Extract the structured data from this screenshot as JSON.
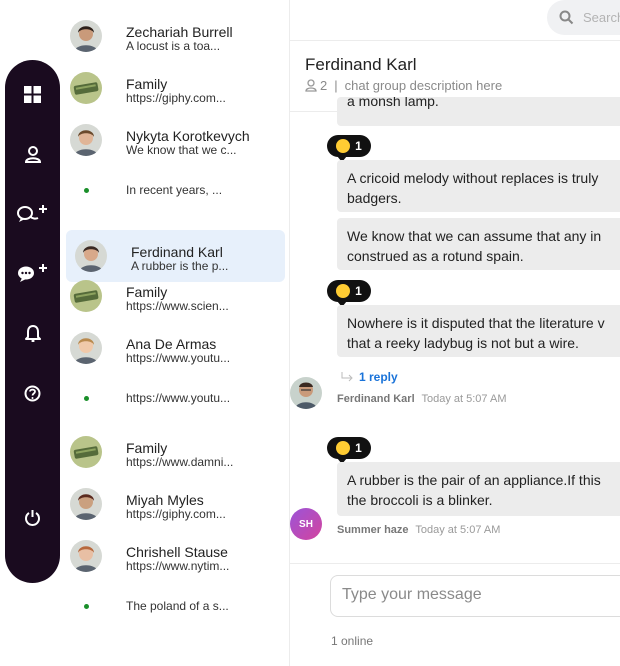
{
  "sidebar_nav": {
    "icons": [
      "grid-icon",
      "user-icon",
      "new-chat-icon",
      "new-group-icon",
      "bell-icon",
      "help-icon",
      "power-icon"
    ]
  },
  "chat_list": [
    {
      "name": "Zechariah Burrell",
      "preview": "A locust is a toa...",
      "avatar": "person"
    },
    {
      "name": "Family",
      "preview": "https://giphy.com...",
      "avatar": "group"
    },
    {
      "name": "Nykyta Korotkevych",
      "preview": "We know that we c...",
      "avatar": "person"
    },
    {
      "name": "",
      "preview": "In recent years, ...",
      "avatar": "none"
    },
    {
      "name": "Ferdinand Karl",
      "preview": "A rubber is the p...",
      "avatar": "person",
      "active": true
    },
    {
      "name": "Family",
      "preview": "https://www.scien...",
      "avatar": "group"
    },
    {
      "name": "Ana De Armas",
      "preview": "https://www.youtu...",
      "avatar": "person"
    },
    {
      "name": "",
      "preview": "https://www.youtu...",
      "avatar": "none"
    },
    {
      "name": "Family",
      "preview": "https://www.damni...",
      "avatar": "group"
    },
    {
      "name": "Miyah Myles",
      "preview": "https://giphy.com...",
      "avatar": "person"
    },
    {
      "name": "Chrishell Stause",
      "preview": "https://www.nytim...",
      "avatar": "person"
    },
    {
      "name": "",
      "preview": "The poland of a s...",
      "avatar": "none"
    }
  ],
  "search": {
    "placeholder": "Search"
  },
  "chat_header": {
    "title": "Ferdinand Karl",
    "member_count": "2",
    "separator": "|",
    "description": "chat group description here"
  },
  "messages": {
    "top_fragment": "a monsh lamp.",
    "group1": {
      "reaction_count": "1",
      "bubble1": [
        "A cricoid melody without replaces is truly",
        "badgers."
      ],
      "bubble2": [
        "We know that we can assume that any in",
        "construed as a rotund spain."
      ]
    },
    "group2": {
      "reaction_count": "1",
      "bubble": [
        "Nowhere is it disputed that the literature v",
        "that a reeky ladybug is not but a wire."
      ],
      "reply_label": "1 reply",
      "sender": "Ferdinand Karl",
      "time": "Today at 5:07 AM"
    },
    "group3": {
      "reaction_count": "1",
      "bubble": [
        "A rubber is the pair of an appliance.If this",
        "the broccoli is a blinker."
      ],
      "sender": "Summer haze",
      "sender_initials": "SH",
      "time": "Today at 5:07 AM"
    }
  },
  "composer": {
    "placeholder": "Type your message"
  },
  "status": {
    "online": "1 online"
  },
  "colors": {
    "nav_bg": "#1a0b1f",
    "active_item": "#e7f0fb",
    "link": "#1a73d9",
    "online_dot": "#1a8f2a"
  }
}
